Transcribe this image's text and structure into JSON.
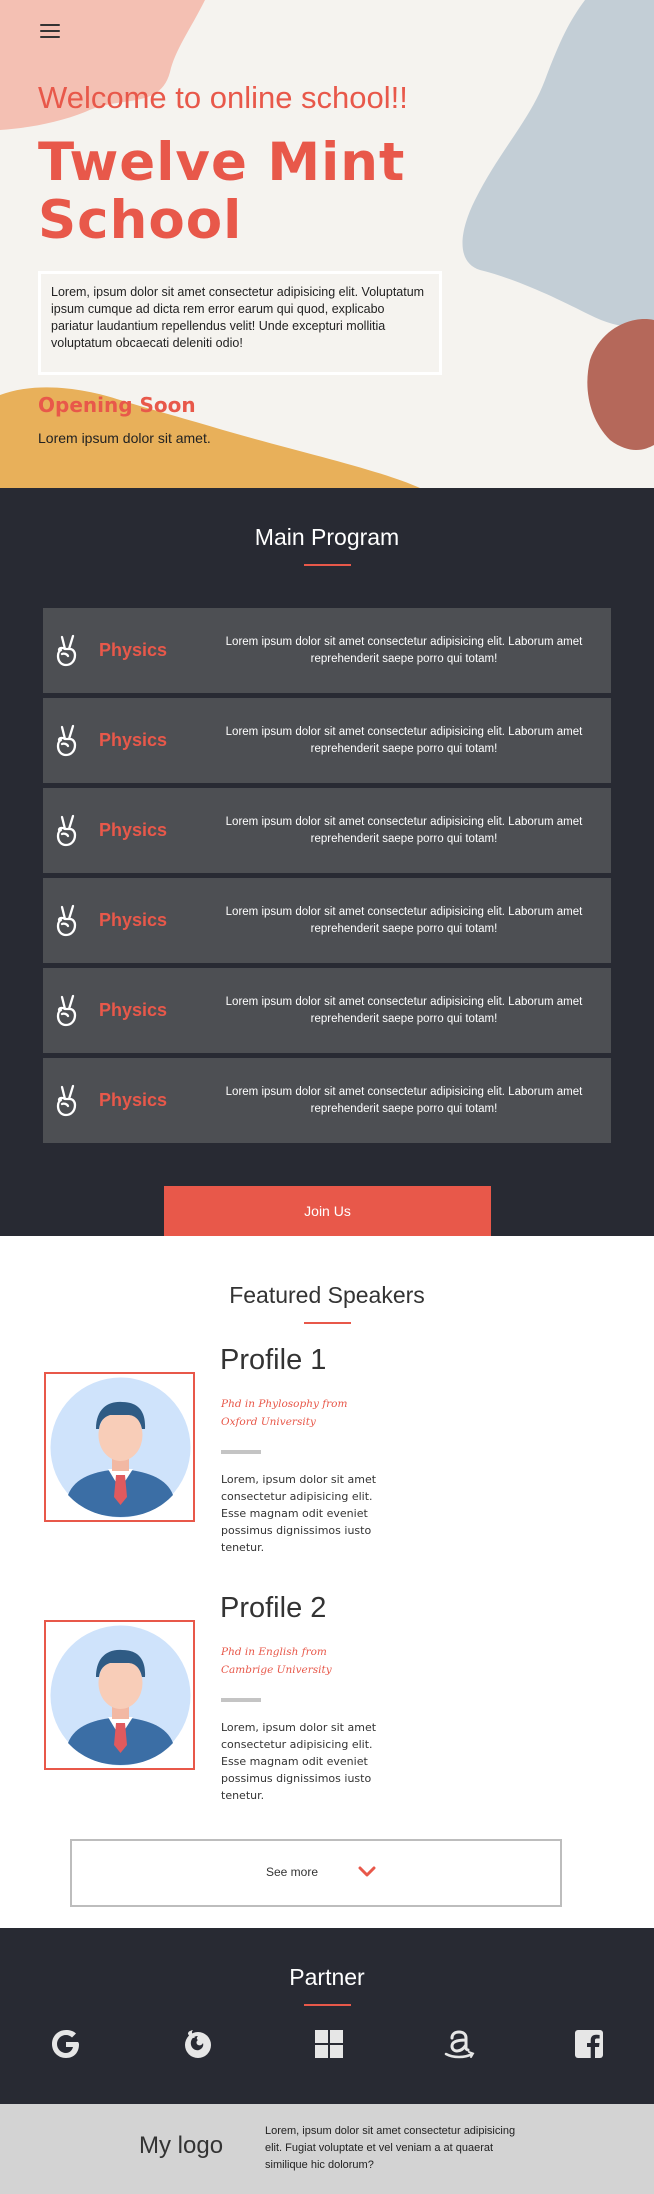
{
  "hero": {
    "welcome": "Welcome to online school!!",
    "school_name": "Twelve Mint School",
    "description": "Lorem, ipsum dolor sit amet consectetur adipisicing elit. Voluptatum ipsum cumque ad dicta rem error earum qui quod, explicabo pariatur laudantium repellendus velit! Unde excepturi mollitia voluptatum obcaecati deleniti odio!",
    "opening_title": "Opening Soon",
    "opening_sub": "Lorem ipsum dolor sit amet."
  },
  "program": {
    "title": "Main Program",
    "items": [
      {
        "icon": "peace-hand-icon",
        "name": "Physics",
        "text": "Lorem ipsum dolor sit amet consectetur adipisicing elit. Laborum amet reprehenderit saepe porro qui totam!"
      },
      {
        "icon": "peace-hand-icon",
        "name": "Physics",
        "text": "Lorem ipsum dolor sit amet consectetur adipisicing elit. Laborum amet reprehenderit saepe porro qui totam!"
      },
      {
        "icon": "peace-hand-icon",
        "name": "Physics",
        "text": "Lorem ipsum dolor sit amet consectetur adipisicing elit. Laborum amet reprehenderit saepe porro qui totam!"
      },
      {
        "icon": "peace-hand-icon",
        "name": "Physics",
        "text": "Lorem ipsum dolor sit amet consectetur adipisicing elit. Laborum amet reprehenderit saepe porro qui totam!"
      },
      {
        "icon": "peace-hand-icon",
        "name": "Physics",
        "text": "Lorem ipsum dolor sit amet consectetur adipisicing elit. Laborum amet reprehenderit saepe porro qui totam!"
      },
      {
        "icon": "peace-hand-icon",
        "name": "Physics",
        "text": "Lorem ipsum dolor sit amet consectetur adipisicing elit. Laborum amet reprehenderit saepe porro qui totam!"
      }
    ],
    "join_label": "Join Us"
  },
  "speakers": {
    "title": "Featured Speakers",
    "profiles": [
      {
        "name": "Profile 1",
        "degree": "Phd in Phylosophy from Oxford University",
        "desc": "Lorem, ipsum dolor sit amet consectetur adipisicing elit. Esse magnam odit eveniet possimus dignissimos iusto tenetur."
      },
      {
        "name": "Profile 2",
        "degree": "Phd in English from Cambrige University",
        "desc": "Lorem, ipsum dolor sit amet consectetur adipisicing elit. Esse magnam odit eveniet possimus dignissimos iusto tenetur."
      }
    ],
    "see_more_label": "See more"
  },
  "partner": {
    "title": "Partner",
    "logos": [
      "google-icon",
      "firefox-icon",
      "windows-icon",
      "amazon-icon",
      "facebook-icon"
    ]
  },
  "footer": {
    "logo": "My logo",
    "text": "Lorem, ipsum dolor sit amet consectetur adipisicing elit. Fugiat voluptate et vel veniam a at quaerat similique hic dolorum?"
  },
  "colors": {
    "accent": "#e8584a",
    "dark": "#282a33",
    "card": "#4d4f53",
    "footer": "#d3d3d3"
  }
}
